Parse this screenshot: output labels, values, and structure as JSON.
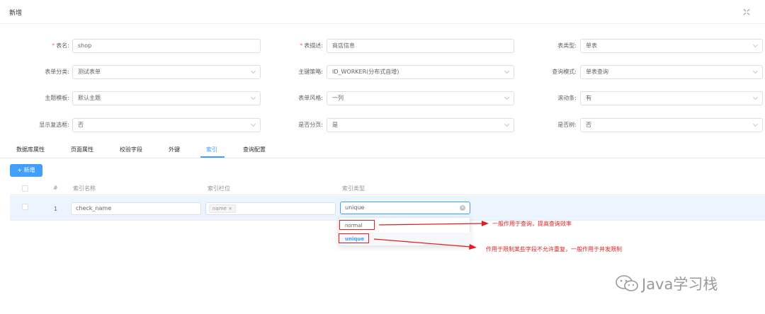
{
  "dialog": {
    "title": "新增",
    "close_icon": "close-icon"
  },
  "form": {
    "rows": [
      [
        {
          "label": "表名:",
          "required": true,
          "value": "shop",
          "type": "input"
        },
        {
          "label": "表描述:",
          "required": true,
          "value": "商店信息",
          "type": "input"
        },
        {
          "label": "表类型:",
          "required": false,
          "value": "单表",
          "type": "select"
        }
      ],
      [
        {
          "label": "表单分类:",
          "required": false,
          "value": "测试表单",
          "type": "select"
        },
        {
          "label": "主键策略:",
          "required": false,
          "value": "ID_WORKER(分布式自增)",
          "type": "select"
        },
        {
          "label": "查询模式:",
          "required": false,
          "value": "单表查询",
          "type": "select"
        }
      ],
      [
        {
          "label": "主题模板:",
          "required": false,
          "value": "默认主题",
          "type": "select"
        },
        {
          "label": "表单风格:",
          "required": false,
          "value": "一列",
          "type": "select"
        },
        {
          "label": "滚动条:",
          "required": false,
          "value": "有",
          "type": "select"
        }
      ],
      [
        {
          "label": "显示复选框:",
          "required": false,
          "value": "否",
          "type": "select"
        },
        {
          "label": "是否分页:",
          "required": false,
          "value": "是",
          "type": "select"
        },
        {
          "label": "是否树:",
          "required": false,
          "value": "否",
          "type": "select"
        }
      ]
    ]
  },
  "tabs": {
    "items": [
      "数据库属性",
      "页面属性",
      "校验字段",
      "外键",
      "索引",
      "查询配置"
    ],
    "active": "索引"
  },
  "toolbar": {
    "add_label": "新增",
    "add_icon": "plus-icon"
  },
  "table": {
    "headers": [
      "#",
      "索引名称",
      "索引栏位",
      "索引类型"
    ],
    "rows": [
      {
        "index": "1",
        "name": "check_name",
        "fields_tag": "name",
        "type": "unique"
      }
    ]
  },
  "dropdown": {
    "options": [
      "normal",
      "unique"
    ],
    "selected": "unique"
  },
  "annotations": {
    "normal": "一般作用于查询，提高查询效率",
    "unique": "作用于限制某些字段不允许重复，一般作用于并发限制"
  },
  "watermark": {
    "text": "Java学习栈",
    "icon": "wechat-icon"
  },
  "colors": {
    "primary": "#409eff",
    "danger": "#e02020",
    "required": "#f56c6c"
  }
}
